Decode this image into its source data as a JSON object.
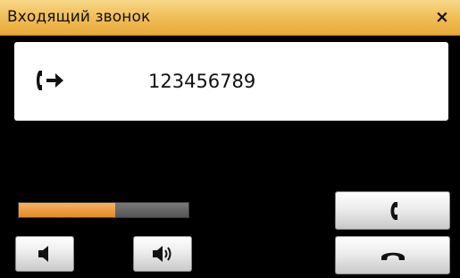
{
  "window": {
    "title": "Входящий звонок",
    "close_label": "×"
  },
  "call": {
    "direction_icon": "incoming-call-icon",
    "number": "123456789"
  },
  "volume": {
    "level": 0.57,
    "fill_color": "#e38a23",
    "track_color": "#5a5a5a"
  },
  "buttons": {
    "volume_down_icon": "speaker-low-icon",
    "volume_up_icon": "speaker-high-icon",
    "answer_icon": "phone-handset-icon",
    "hangup_icon": "hang-up-icon"
  },
  "colors": {
    "titlebar": "#f1bf5a",
    "background": "#000000"
  }
}
